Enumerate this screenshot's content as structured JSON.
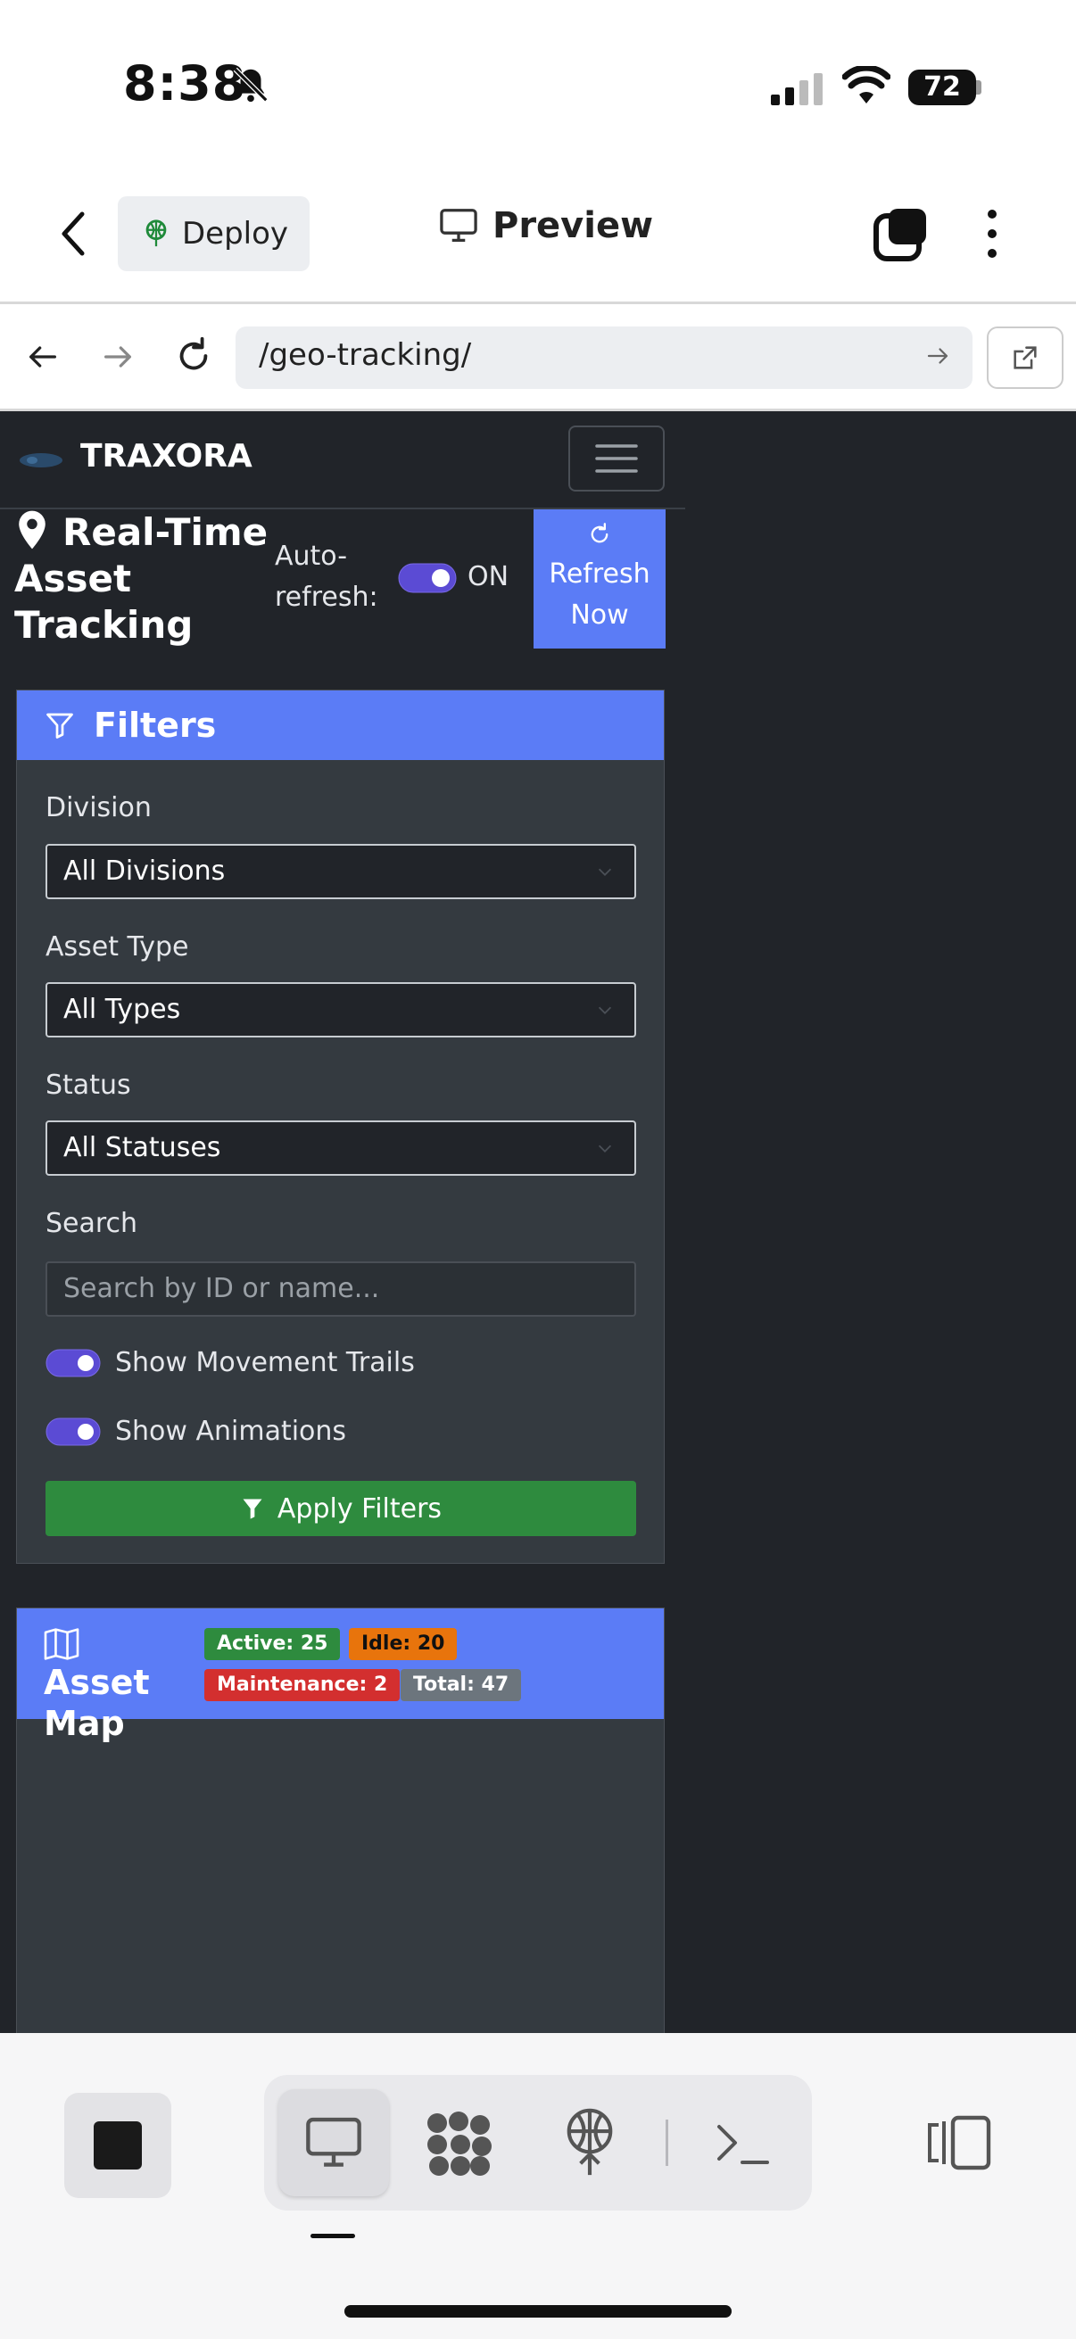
{
  "status_bar": {
    "time": "8:38",
    "battery": "72",
    "icons": [
      "bell-slash-icon",
      "cellular-signal-icon",
      "wifi-icon",
      "battery-icon"
    ]
  },
  "app_header": {
    "deploy_label": "Deploy",
    "preview_label": "Preview"
  },
  "browser": {
    "url": "/geo-tracking/"
  },
  "page": {
    "brand": "TRAXORA",
    "title": "Real-Time Asset Tracking",
    "auto_refresh_label": "Auto-refresh:",
    "auto_refresh_on": true,
    "auto_refresh_state": "ON",
    "refresh_button": "Refresh Now",
    "filters": {
      "heading": "Filters",
      "division_label": "Division",
      "division_value": "All Divisions",
      "asset_type_label": "Asset Type",
      "asset_type_value": "All Types",
      "status_label": "Status",
      "status_value": "All Statuses",
      "search_label": "Search",
      "search_placeholder": "Search by ID or name...",
      "show_trails_label": "Show Movement Trails",
      "show_trails_on": true,
      "show_animations_label": "Show Animations",
      "show_animations_on": true,
      "apply_button": "Apply Filters"
    },
    "map": {
      "heading": "Asset Map",
      "badges": {
        "active": "Active: 25",
        "idle": "Idle: 20",
        "maintenance": "Maintenance: 2",
        "total": "Total: 47"
      }
    }
  },
  "colors": {
    "accent": "#5b7cf6",
    "toggle": "#5b4bd4",
    "success": "#2e8b3e",
    "warning": "#e8740c",
    "danger": "#d32f2f",
    "secondary": "#6c757d",
    "page_bg": "#212429",
    "card_bg": "#343a40"
  }
}
